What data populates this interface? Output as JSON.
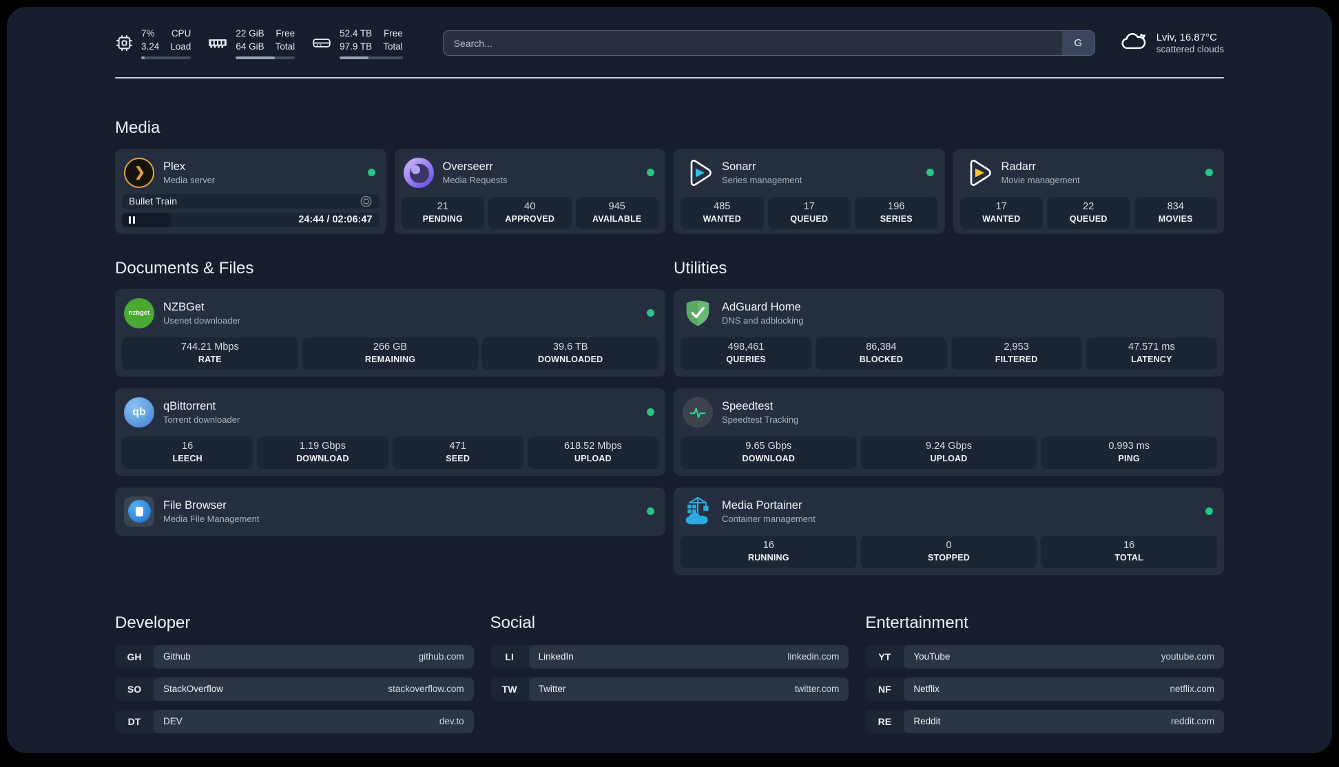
{
  "topbar": {
    "cpu": {
      "value_top": "7%",
      "value_bottom": "3.24",
      "label_top": "CPU",
      "label_bottom": "Load",
      "progress_pct": 7
    },
    "memory": {
      "value_top": "22 GiB",
      "value_bottom": "64 GiB",
      "label_top": "Free",
      "label_bottom": "Total",
      "progress_pct": 66
    },
    "disk": {
      "value_top": "52.4 TB",
      "value_bottom": "97.9 TB",
      "label_top": "Free",
      "label_bottom": "Total",
      "progress_pct": 46
    },
    "search": {
      "placeholder": "Search...",
      "engine_button": "G"
    },
    "weather": {
      "location_temp": "Lviv, 16.87°C",
      "condition": "scattered clouds"
    }
  },
  "sections": {
    "media": {
      "title": "Media"
    },
    "documents": {
      "title": "Documents & Files"
    },
    "utilities": {
      "title": "Utilities"
    },
    "developer": {
      "title": "Developer"
    },
    "social": {
      "title": "Social"
    },
    "entertainment": {
      "title": "Entertainment"
    }
  },
  "apps": {
    "plex": {
      "title": "Plex",
      "subtitle": "Media server",
      "status": "online",
      "icon_glyph": "❯",
      "now_playing": {
        "title": "Bullet Train",
        "time_display": "24:44 / 02:06:47",
        "progress_pct": 19
      }
    },
    "overseerr": {
      "title": "Overseerr",
      "subtitle": "Media Requests",
      "status": "online",
      "stats": [
        {
          "value": "21",
          "label": "PENDING"
        },
        {
          "value": "40",
          "label": "APPROVED"
        },
        {
          "value": "945",
          "label": "AVAILABLE"
        }
      ]
    },
    "sonarr": {
      "title": "Sonarr",
      "subtitle": "Series management",
      "status": "online",
      "stats": [
        {
          "value": "485",
          "label": "WANTED"
        },
        {
          "value": "17",
          "label": "QUEUED"
        },
        {
          "value": "196",
          "label": "SERIES"
        }
      ]
    },
    "radarr": {
      "title": "Radarr",
      "subtitle": "Movie management",
      "status": "online",
      "stats": [
        {
          "value": "17",
          "label": "WANTED"
        },
        {
          "value": "22",
          "label": "QUEUED"
        },
        {
          "value": "834",
          "label": "MOVIES"
        }
      ]
    },
    "nzbget": {
      "title": "NZBGet",
      "subtitle": "Usenet downloader",
      "status": "online",
      "icon_text": "nzbget",
      "stats": [
        {
          "value": "744.21 Mbps",
          "label": "RATE"
        },
        {
          "value": "266 GB",
          "label": "REMAINING"
        },
        {
          "value": "39.6 TB",
          "label": "DOWNLOADED"
        }
      ]
    },
    "qbittorrent": {
      "title": "qBittorrent",
      "subtitle": "Torrent downloader",
      "status": "online",
      "icon_text": "qb",
      "stats": [
        {
          "value": "16",
          "label": "LEECH"
        },
        {
          "value": "1.19 Gbps",
          "label": "DOWNLOAD"
        },
        {
          "value": "471",
          "label": "SEED"
        },
        {
          "value": "618.52 Mbps",
          "label": "UPLOAD"
        }
      ]
    },
    "filebrowser": {
      "title": "File Browser",
      "subtitle": "Media File Management",
      "status": "online"
    },
    "adguard": {
      "title": "AdGuard Home",
      "subtitle": "DNS and adblocking",
      "stats": [
        {
          "value": "498,461",
          "label": "QUERIES"
        },
        {
          "value": "86,384",
          "label": "BLOCKED"
        },
        {
          "value": "2,953",
          "label": "FILTERED"
        },
        {
          "value": "47.571 ms",
          "label": "LATENCY"
        }
      ]
    },
    "speedtest": {
      "title": "Speedtest",
      "subtitle": "Speedtest Tracking",
      "stats": [
        {
          "value": "9.65 Gbps",
          "label": "DOWNLOAD"
        },
        {
          "value": "9.24 Gbps",
          "label": "UPLOAD"
        },
        {
          "value": "0.993 ms",
          "label": "PING"
        }
      ]
    },
    "portainer": {
      "title": "Media Portainer",
      "subtitle": "Container management",
      "status": "online",
      "stats": [
        {
          "value": "16",
          "label": "RUNNING"
        },
        {
          "value": "0",
          "label": "STOPPED"
        },
        {
          "value": "16",
          "label": "TOTAL"
        }
      ]
    }
  },
  "bookmarks": {
    "developer": [
      {
        "abbr": "GH",
        "name": "Github",
        "url": "github.com"
      },
      {
        "abbr": "SO",
        "name": "StackOverflow",
        "url": "stackoverflow.com"
      },
      {
        "abbr": "DT",
        "name": "DEV",
        "url": "dev.to"
      }
    ],
    "social": [
      {
        "abbr": "LI",
        "name": "LinkedIn",
        "url": "linkedin.com"
      },
      {
        "abbr": "TW",
        "name": "Twitter",
        "url": "twitter.com"
      }
    ],
    "entertainment": [
      {
        "abbr": "YT",
        "name": "YouTube",
        "url": "youtube.com"
      },
      {
        "abbr": "NF",
        "name": "Netflix",
        "url": "netflix.com"
      },
      {
        "abbr": "RE",
        "name": "Reddit",
        "url": "reddit.com"
      }
    ]
  },
  "colors": {
    "status_online": "#26c685",
    "plex_accent": "#e6a23c"
  }
}
